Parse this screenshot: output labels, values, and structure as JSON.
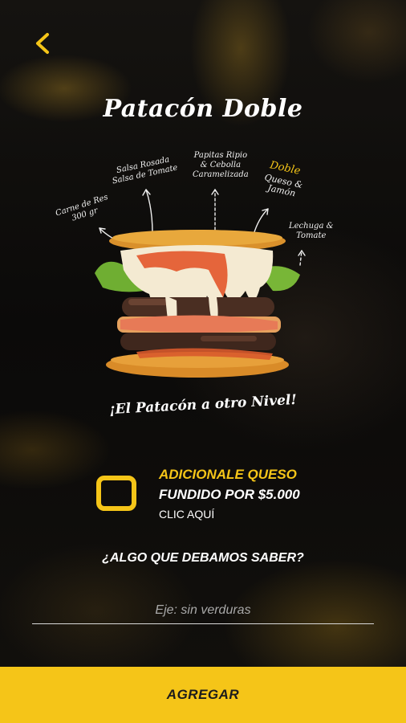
{
  "header": {
    "back_icon": "chevron-left-icon",
    "accent_color": "#f5c518"
  },
  "product": {
    "title": "Patacón Doble",
    "slogan": "¡El Patacón a otro Nivel!",
    "annotations": {
      "carne": "Carne de Res\n300 gr",
      "salsa": "Salsa Rosada\nSalsa de Tomate",
      "papitas": "Papitas Ripio\n& Cebolla\nCaramelizada",
      "doble": "Doble",
      "queso": "Queso &\nJamón",
      "lechuga": "Lechuga &\nTomate"
    }
  },
  "addon": {
    "line1": "ADICIONALE QUESO",
    "line2": "FUNDIDO POR $5.000",
    "line3": "CLIC AQUÍ",
    "checked": false
  },
  "notes": {
    "question": "¿ALGO QUE DEBAMOS SABER?",
    "placeholder": "Eje: sin verduras",
    "value": ""
  },
  "footer": {
    "add_label": "AGREGAR"
  }
}
